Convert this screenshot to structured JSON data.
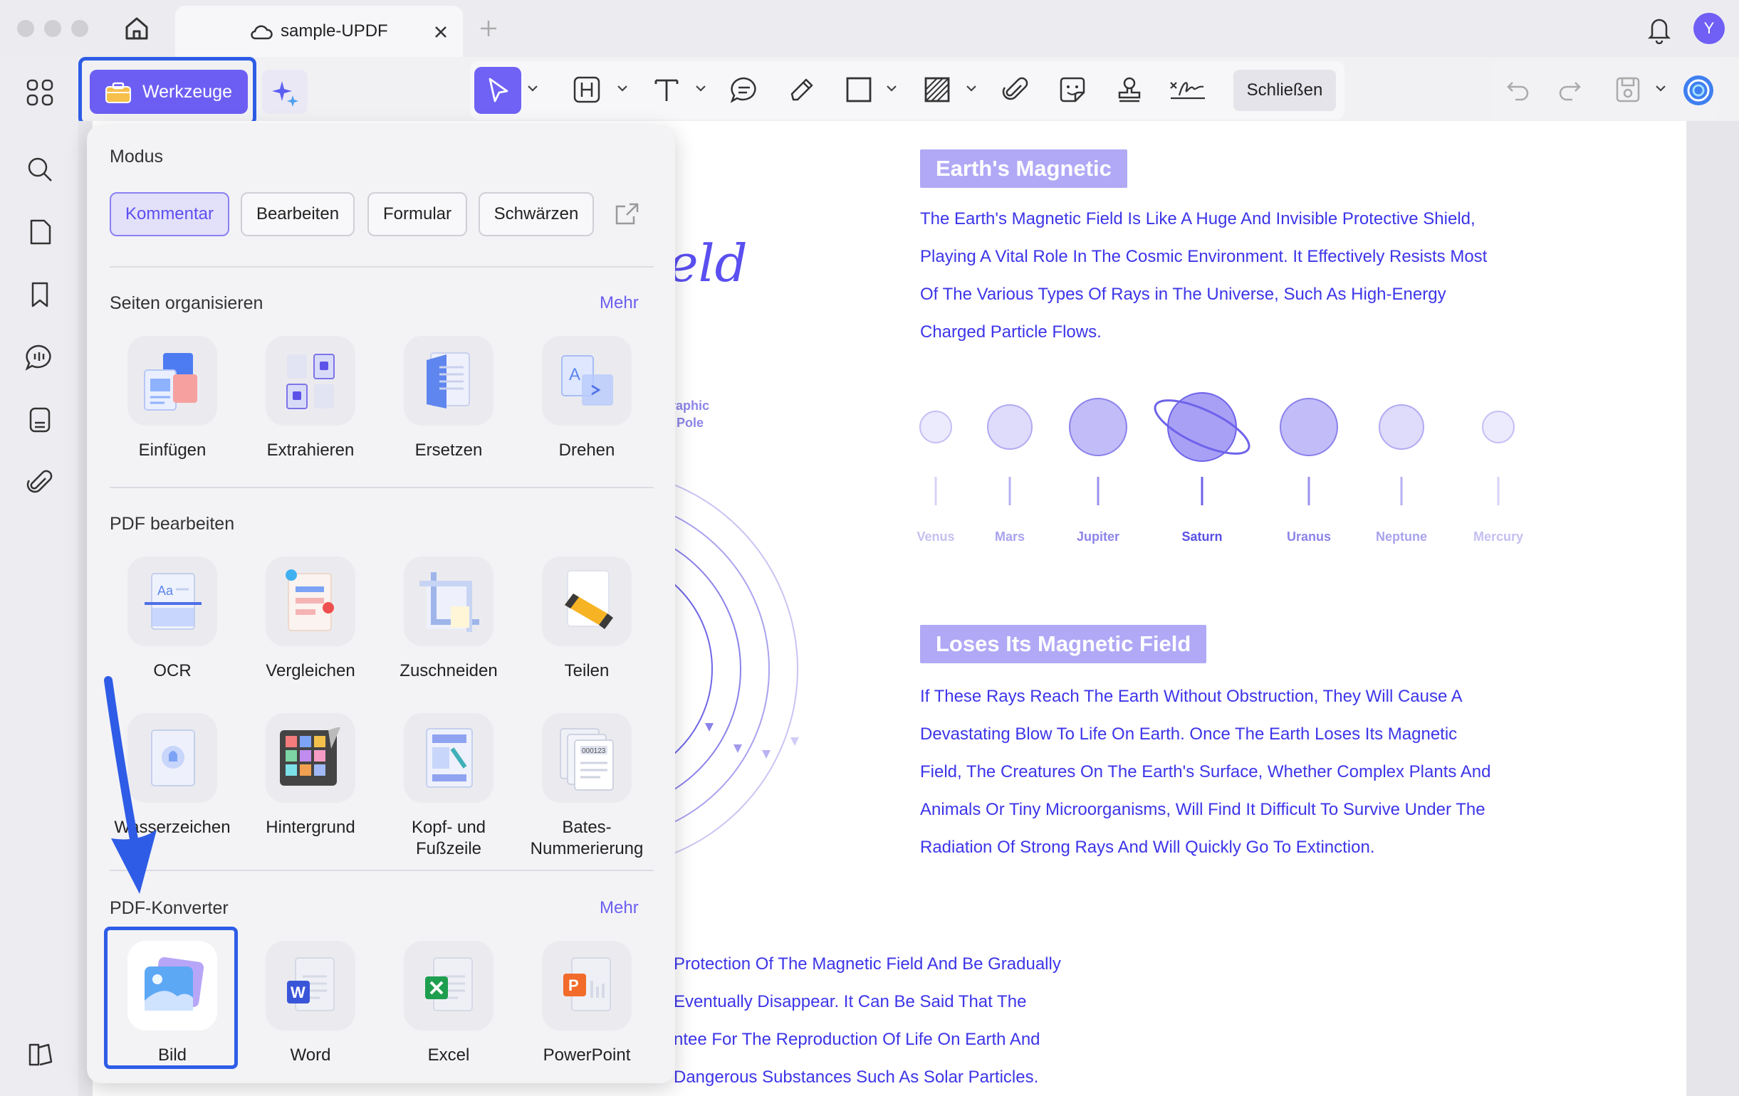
{
  "window": {
    "tab_title": "sample-UPDF",
    "avatar_initial": "Y"
  },
  "toolbar": {
    "tools_label": "Werkzeuge",
    "close_label": "Schließen"
  },
  "panel": {
    "mode_title": "Modus",
    "modes": [
      "Kommentar",
      "Bearbeiten",
      "Formular",
      "Schwärzen"
    ],
    "organize_title": "Seiten organisieren",
    "organize_more": "Mehr",
    "organize_items": [
      "Einfügen",
      "Extrahieren",
      "Ersetzen",
      "Drehen"
    ],
    "edit_title": "PDF bearbeiten",
    "edit_items_row1": [
      "OCR",
      "Vergleichen",
      "Zuschneiden",
      "Teilen"
    ],
    "edit_items_row2": [
      "Wasserzeichen",
      "Hintergrund",
      "Kopf- und Fußzeile",
      "Bates-Nummerierung"
    ],
    "convert_title": "PDF-Konverter",
    "convert_more": "Mehr",
    "convert_items": [
      "Bild",
      "Word",
      "Excel",
      "PowerPoint"
    ]
  },
  "document": {
    "partial_title": "eld",
    "partial_label": "raphic\nPole",
    "heading1": "Earth's Magnetic",
    "para1": [
      "The Earth's Magnetic Field Is Like A Huge And Invisible Protective Shield,",
      "Playing A Vital Role In The Cosmic Environment. It Effectively Resists Most",
      "Of The Various Types Of Rays in The Universe, Such As High-Energy",
      "Charged Particle Flows."
    ],
    "planets": [
      "Venus",
      "Mars",
      "Jupiter",
      "Saturn",
      "Uranus",
      "Neptune",
      "Mercury"
    ],
    "heading2": "Loses Its Magnetic Field",
    "para2": [
      "If These Rays Reach The Earth Without Obstruction, They Will Cause A",
      "Devastating Blow To Life On Earth. Once The Earth Loses Its Magnetic",
      "Field, The Creatures On The Earth's Surface, Whether Complex Plants And",
      "Animals Or Tiny Microorganisms, Will Find It Difficult To Survive Under The",
      "Radiation Of Strong Rays And Will Quickly Go To Extinction."
    ],
    "para3": [
      "Protection Of The Magnetic Field And Be Gradually",
      "Eventually Disappear. It Can Be Said That The",
      "ntee For The Reproduction Of Life On Earth And",
      "Dangerous Substances Such As Solar Particles."
    ]
  },
  "colors": {
    "accent": "#6d5ef3",
    "highlight_border": "#2e5ce6",
    "doc_text": "#3d35e8",
    "heading_bg": "#b1a9f5"
  }
}
